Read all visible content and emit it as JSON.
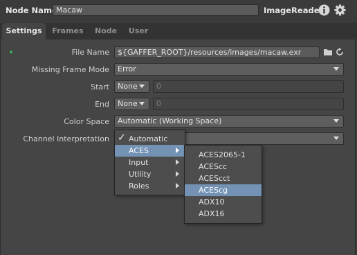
{
  "header": {
    "node_name_label": "Node Name",
    "node_name_value": "Macaw",
    "node_type": "ImageReader",
    "info_icon": "info-icon",
    "settings_icon": "gear-icon"
  },
  "tabs": [
    {
      "label": "Settings",
      "active": true
    },
    {
      "label": "Frames",
      "active": false
    },
    {
      "label": "Node",
      "active": false
    },
    {
      "label": "User",
      "active": false
    }
  ],
  "params": {
    "file_name": {
      "label": "File Name",
      "value": "${GAFFER_ROOT}/resources/images/macaw.exr"
    },
    "missing_frame_mode": {
      "label": "Missing Frame Mode",
      "value": "Error"
    },
    "start": {
      "label": "Start",
      "mode": "None",
      "value": "0"
    },
    "end": {
      "label": "End",
      "mode": "None",
      "value": "0"
    },
    "color_space": {
      "label": "Color Space",
      "value": "Automatic (Working Space)"
    },
    "channel_interpretation": {
      "label": "Channel Interpretation",
      "value": ""
    }
  },
  "menu": {
    "items": [
      {
        "label": "Automatic",
        "checked": true,
        "submenu": false,
        "highlighted": false
      },
      {
        "label": "ACES",
        "checked": false,
        "submenu": true,
        "highlighted": true
      },
      {
        "label": "Input",
        "checked": false,
        "submenu": true,
        "highlighted": false
      },
      {
        "label": "Utility",
        "checked": false,
        "submenu": true,
        "highlighted": false
      },
      {
        "label": "Roles",
        "checked": false,
        "submenu": true,
        "highlighted": false
      }
    ],
    "check_glyph": "✓"
  },
  "submenu": {
    "items": [
      {
        "label": "ACES2065-1",
        "highlighted": false
      },
      {
        "label": "ACEScc",
        "highlighted": false
      },
      {
        "label": "ACEScct",
        "highlighted": false
      },
      {
        "label": "ACEScg",
        "highlighted": true
      },
      {
        "label": "ADX10",
        "highlighted": false
      },
      {
        "label": "ADX16",
        "highlighted": false
      }
    ]
  },
  "colors": {
    "highlight": "#7392b4",
    "panel": "#454545",
    "indicator": "#3cae5a"
  }
}
